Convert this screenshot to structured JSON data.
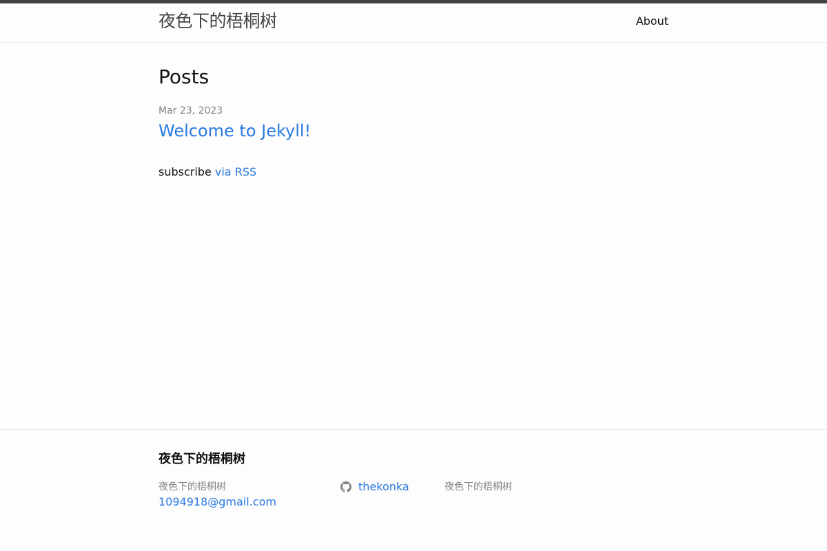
{
  "header": {
    "site_title": "夜色下的梧桐树",
    "nav": [
      {
        "label": "About"
      }
    ]
  },
  "main": {
    "heading": "Posts",
    "posts": [
      {
        "date": "Mar 23, 2023",
        "title": "Welcome to Jekyll!"
      }
    ],
    "rss": {
      "prefix": "subscribe",
      "link_label": "via RSS"
    }
  },
  "footer": {
    "heading": "夜色下的梧桐树",
    "name": "夜色下的梧桐树",
    "email": "1094918@gmail.com",
    "github": {
      "icon": "github-icon",
      "username": "thekonka"
    },
    "description": "夜色下的梧桐树"
  },
  "colors": {
    "background": "#fdfdfd",
    "text": "#111111",
    "link": "#2a7ae2",
    "muted": "#828282",
    "border": "#e8e8e8",
    "top_bar": "#424242"
  }
}
